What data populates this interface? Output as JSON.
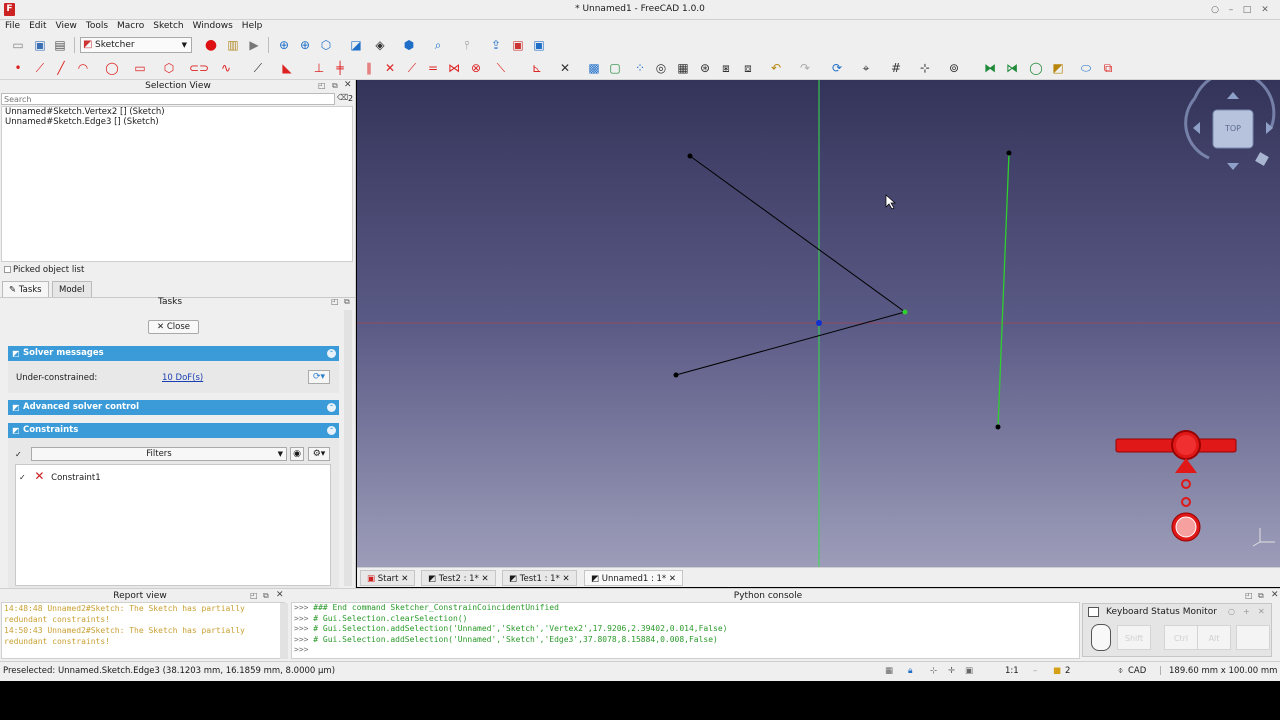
{
  "window": {
    "title": "* Unnamed1 - FreeCAD 1.0.0",
    "app_icon": "F"
  },
  "menu": [
    "File",
    "Edit",
    "View",
    "Tools",
    "Macro",
    "Sketch",
    "Windows",
    "Help"
  ],
  "toolbar": {
    "workbench": "Sketcher"
  },
  "selection_view": {
    "title": "Selection View",
    "search_placeholder": "Search",
    "count": "2",
    "items": [
      "Unnamed#Sketch.Vertex2 [] (Sketch)",
      "Unnamed#Sketch.Edge3 [] (Sketch)"
    ],
    "picked_label": "Picked object list"
  },
  "panel_tabs": {
    "tasks": "Tasks",
    "model": "Model"
  },
  "tasks": {
    "title": "Tasks",
    "close_label": "Close",
    "solver_header": "Solver messages",
    "under_label": "Under-constrained:",
    "dof_link": "10 DoF(s)",
    "advanced_header": "Advanced solver control",
    "constraints_header": "Constraints",
    "filters_label": "Filters",
    "constraint_item": "Constraint1"
  },
  "nav_cube": {
    "face_label": "TOP"
  },
  "view_tabs": [
    "Start",
    "Test2 : 1*",
    "Test1 : 1*",
    "Unnamed1 : 1*"
  ],
  "report": {
    "title": "Report view",
    "lines": [
      "14:48:48  Unnamed2#Sketch: The Sketch has partially",
      "redundant constraints!",
      "14:50:43  Unnamed2#Sketch: The Sketch has partially",
      "redundant constraints!"
    ]
  },
  "python": {
    "title": "Python console",
    "lines": [
      "### End command Sketcher_ConstrainCoincidentUnified",
      "# Gui.Selection.clearSelection()",
      "# Gui.Selection.addSelection('Unnamed','Sketch','Vertex2',17.9206,2.39402,0.014,False)",
      "# Gui.Selection.addSelection('Unnamed','Sketch','Edge3',37.8078,8.15884,0.008,False)",
      ""
    ],
    "prompt": ">>>"
  },
  "keyboard_monitor": {
    "title": "Keyboard Status Monitor",
    "keys": [
      "Shift",
      "Ctrl",
      "Alt",
      ""
    ]
  },
  "status": {
    "text": "Preselected: Unnamed.Sketch.Edge3 (38.1203 mm, 16.1859 mm, 8.0000 µm)",
    "scale": "1:1",
    "layers": "2",
    "nav_style": "CAD",
    "dimensions": "189.60 mm x 100.00 mm"
  },
  "colors": {
    "accent_blue": "#3a9bd8",
    "sketch_green": "#2fcf2f",
    "axis_red": "#d94040",
    "viewport_top": "#34345a",
    "viewport_bottom": "#9d9dba"
  }
}
